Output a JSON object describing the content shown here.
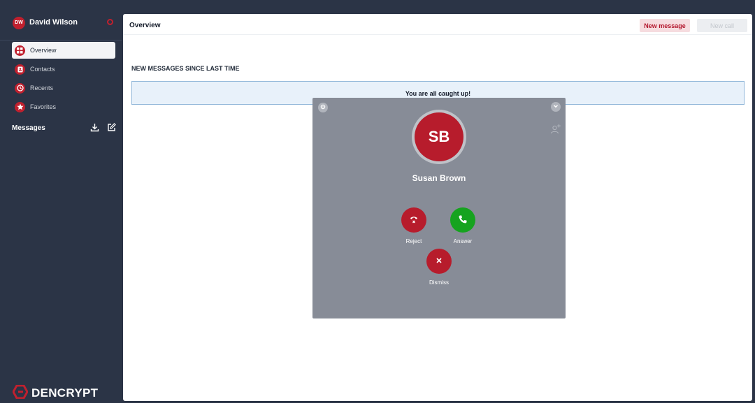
{
  "user": {
    "initials": "DW",
    "name": "David Wilson"
  },
  "sidebar": {
    "items": [
      {
        "label": "Overview",
        "icon": "grid-icon",
        "active": true
      },
      {
        "label": "Contacts",
        "icon": "contact-book-icon",
        "active": false
      },
      {
        "label": "Recents",
        "icon": "clock-icon",
        "active": false
      },
      {
        "label": "Favorites",
        "icon": "star-icon",
        "active": false
      }
    ],
    "messages_label": "Messages"
  },
  "brand": {
    "name": "DENCRYPT"
  },
  "header": {
    "title": "Overview",
    "new_message_label": "New message",
    "new_call_label": "New call"
  },
  "main": {
    "section_title": "NEW MESSAGES SINCE LAST TIME",
    "empty_state": "You are all caught up!"
  },
  "call": {
    "caller_initials": "SB",
    "caller_name": "Susan Brown",
    "reject_label": "Reject",
    "answer_label": "Answer",
    "dismiss_label": "Dismiss"
  },
  "colors": {
    "accent_red": "#b71c2c",
    "answer_green": "#16a31f",
    "sidebar_bg": "#2b3446",
    "overlay_gray": "#878c97"
  }
}
